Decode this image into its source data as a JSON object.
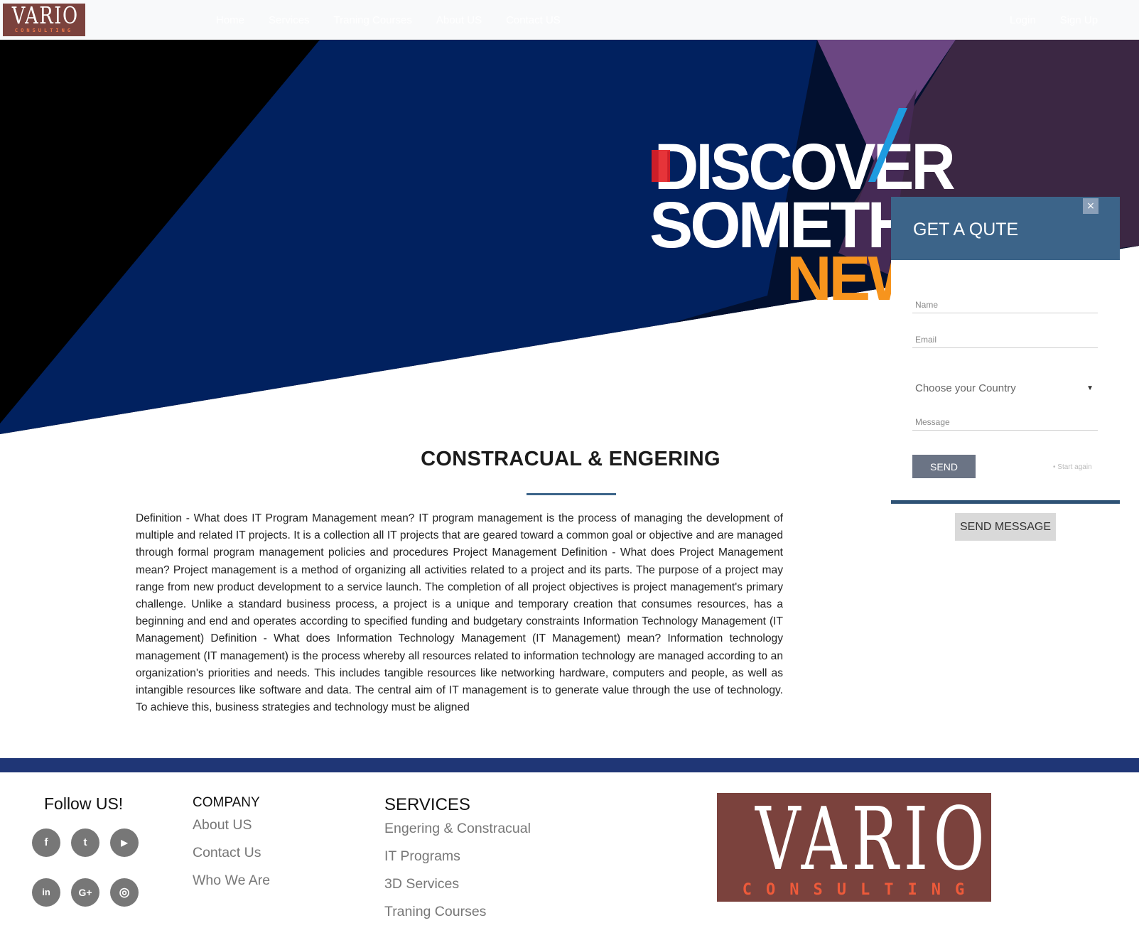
{
  "brand": {
    "name": "VARIO",
    "tagline": "CONSULTING",
    "color": "#7b423d"
  },
  "nav": {
    "links": [
      "Home",
      "Services",
      "Traning Courses",
      "About US",
      "Contact US"
    ],
    "login": "Login",
    "signup": "Sign Up"
  },
  "hero": {
    "line1": "DISCOVER",
    "line2": "SOMETHING",
    "line3": "NEW"
  },
  "quote": {
    "title": "GET A QUTE",
    "close": "×",
    "name_placeholder": "Name",
    "email_placeholder": "Email",
    "country": "Choose your Country",
    "message_placeholder": "Message",
    "send": "SEND",
    "start_again": "• Start again",
    "send_message": "SEND MESSAGE"
  },
  "content": {
    "title": "CONSTRACUAL & ENGERING",
    "body": "Definition - What does IT Program Management mean? IT program management is the process of managing the development of multiple and related IT projects. It is a collection all IT projects that are geared toward a common goal or objective and are managed through formal program management policies and procedures Project Management Definition - What does Project Management mean? Project management is a method of organizing all activities related to a project and its parts. The purpose of a project may range from new product development to a service launch. The completion of all project objectives is project management's primary challenge. Unlike a standard business process, a project is a unique and temporary creation that consumes resources, has a beginning and end and operates according to specified funding and budgetary constraints Information Technology Management (IT Management) Definition - What does Information Technology Management (IT Management) mean? Information technology management (IT management) is the process whereby all resources related to information technology are managed according to an organization's priorities and needs. This includes tangible resources like networking hardware, computers and people, as well as intangible resources like software and data. The central aim of IT management is to generate value through the use of technology. To achieve this, business strategies and technology must be aligned"
  },
  "footer": {
    "follow": "Follow US!",
    "social": [
      {
        "icon": "facebook-icon",
        "glyph": "f"
      },
      {
        "icon": "twitter-icon",
        "glyph": "t"
      },
      {
        "icon": "youtube-icon",
        "glyph": "▶"
      },
      {
        "icon": "linkedin-icon",
        "glyph": "in"
      },
      {
        "icon": "google-plus-icon",
        "glyph": "G+"
      },
      {
        "icon": "instagram-icon",
        "glyph": "◎"
      }
    ],
    "company": {
      "title": "COMPANY",
      "links": [
        "About US",
        "Contact Us",
        "Who We Are"
      ]
    },
    "services": {
      "title": "SERVICES",
      "links": [
        "Engering & Constracual",
        "IT Programs",
        "3D Services",
        "Traning Courses"
      ]
    }
  },
  "colors": {
    "accent": "#3c6489",
    "footer_band": "#1f3676"
  }
}
